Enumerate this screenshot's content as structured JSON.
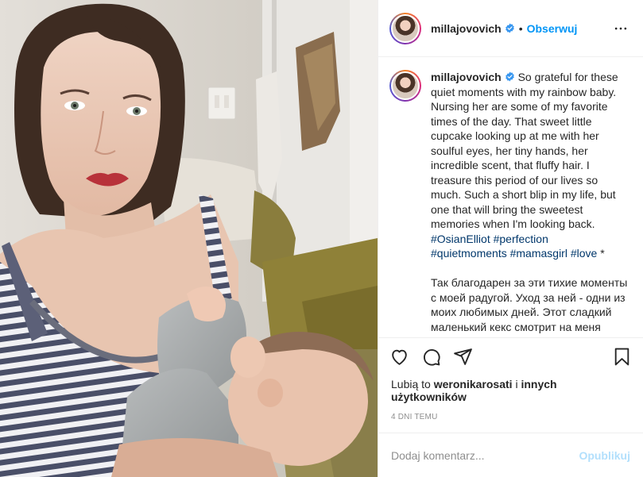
{
  "post": {
    "username": "millajovovich",
    "follow_label": "Obserwuj",
    "separator": "•",
    "caption": {
      "english": "So grateful for these quiet moments with my rainbow baby. Nursing her are some of my favorite times of the day. That sweet little cupcake looking up at me with her soulful eyes, her tiny hands, her incredible scent, that fluffy hair. I treasure this period of our lives so much. Such a short blip in my life, but one that will bring the sweetest memories when I'm looking back.",
      "hashtags_line1": "#OsianElliot #perfection",
      "hashtags_line2": "#quietmoments #mamasgirl #love",
      "hashtags_suffix": " *",
      "russian": "Так благодарен за эти тихие моменты с моей радугой. Уход за ней - одни из моих любимых дней. Этот сладкий маленький кекс смотрит на меня своими проникновенными глазами"
    },
    "likes": {
      "prefix": "Lubią to",
      "user": "weronikarosati",
      "joiner": "i",
      "others": "innych użytkowników"
    },
    "time": "4 DNI TEMU",
    "comment_placeholder": "Dodaj komentarz...",
    "publish_label": "Opublikuj"
  },
  "icons": {
    "verified": "verified-badge-icon",
    "more": "more-options-icon",
    "like": "heart-icon",
    "comment": "comment-bubble-icon",
    "share": "paper-plane-icon",
    "save": "bookmark-icon"
  },
  "colors": {
    "link": "#0095f6",
    "hashtag": "#00376b",
    "muted": "#8e8e8e",
    "publish_disabled": "#b2dffc"
  }
}
